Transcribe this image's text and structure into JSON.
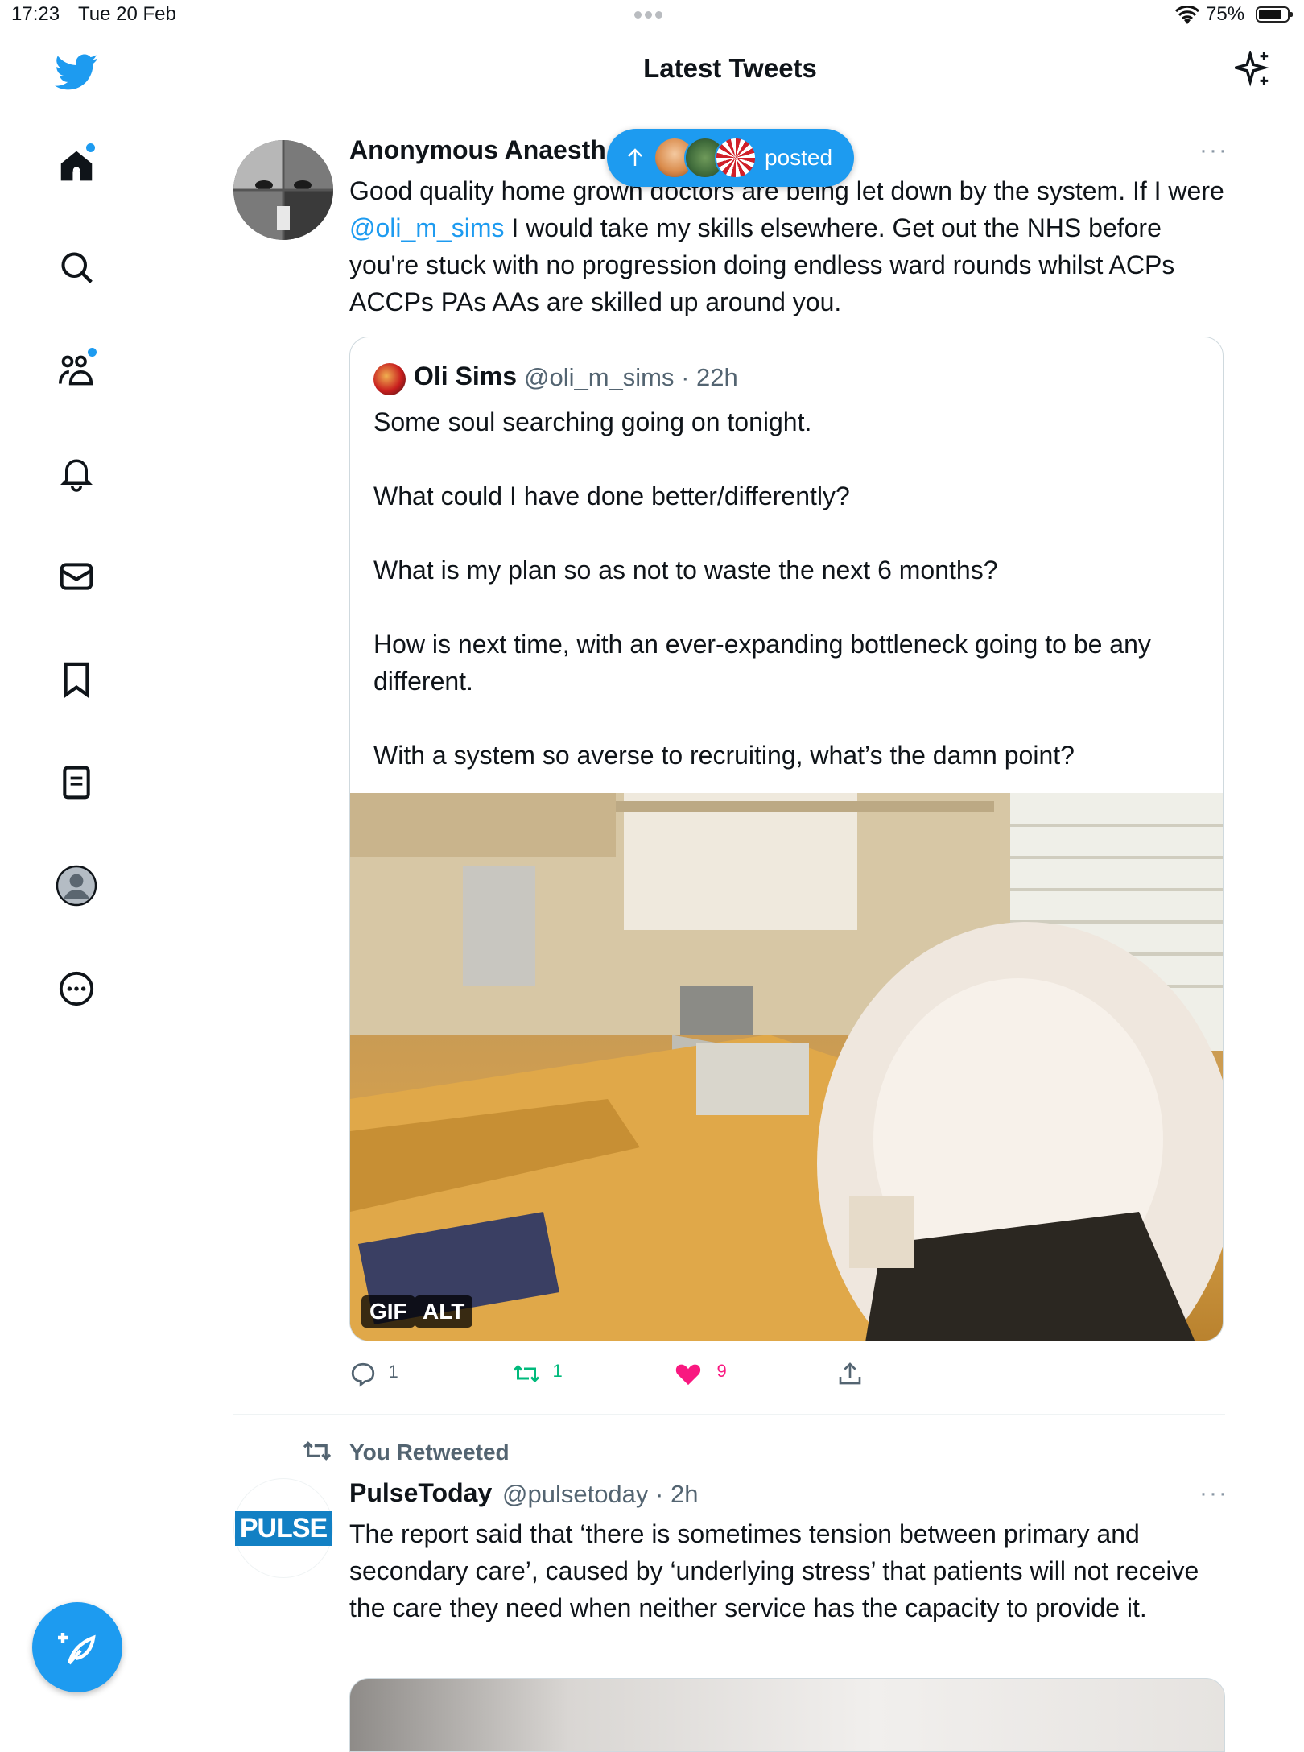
{
  "status_bar": {
    "time": "17:23",
    "date": "Tue 20 Feb",
    "battery": "75%"
  },
  "header": {
    "title": "Latest Tweets"
  },
  "sidebar": {
    "items": [
      {
        "icon": "home-icon"
      },
      {
        "icon": "search-icon"
      },
      {
        "icon": "communities-icon"
      },
      {
        "icon": "bell-icon"
      },
      {
        "icon": "mail-icon"
      },
      {
        "icon": "bookmark-icon"
      },
      {
        "icon": "lists-icon"
      },
      {
        "icon": "profile-icon"
      },
      {
        "icon": "more-icon"
      }
    ]
  },
  "new_posts_pill": {
    "label": "posted"
  },
  "tweets": [
    {
      "name": "Anonymous Anaesth",
      "text_before": "Good quality home grown doctors are being let down by the system. If I were ",
      "mention": "@oli_m_sims",
      "text_after": " I would take my skills elsewhere. Get out the NHS before you're stuck with no progression doing endless ward rounds whilst ACPs ACCPs PAs AAs are skilled up around you.",
      "quote": {
        "name": "Oli Sims",
        "handle_time": "@oli_m_sims · 22h",
        "paragraphs": [
          "Some soul searching going on tonight.",
          "What could I have done better/differently?",
          "What is my plan so as not to waste the next 6 months?",
          "How is next time, with an ever-expanding bottleneck going to be any different.",
          "With a system so averse to recruiting, what’s the damn point?"
        ],
        "badges": {
          "gif": "GIF",
          "alt": "ALT"
        }
      },
      "actions": {
        "replies": "1",
        "retweets": "1",
        "likes": "9"
      }
    },
    {
      "retweet_label": "You Retweeted",
      "name": "PulseToday",
      "handle_time": "@pulsetoday · 2h",
      "avatar_text": "PULSE",
      "text": "The report said that ‘there is sometimes tension between primary and secondary care’, caused by ‘underlying stress’ that patients will not receive the care they need when neither service has the capacity to provide it."
    }
  ],
  "colors": {
    "accent": "#1d9bf0",
    "retweet": "#00ba7c",
    "like": "#f91880",
    "secondary_text": "#536471"
  }
}
